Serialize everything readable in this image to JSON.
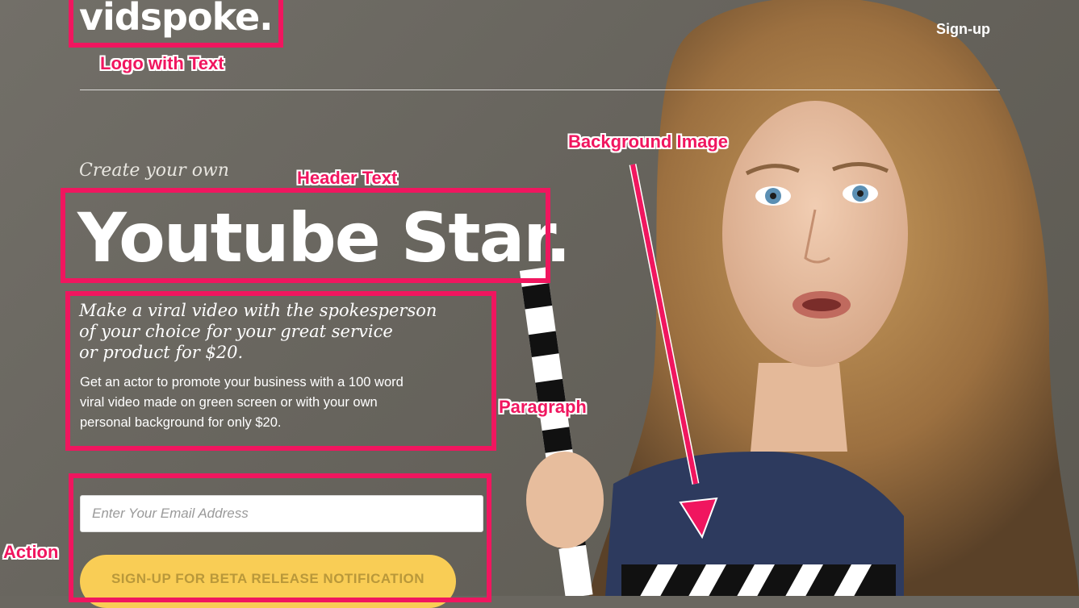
{
  "header": {
    "logo_text": "vidspoke.",
    "signup_link": "Sign-up"
  },
  "hero": {
    "tagline": "Create your own",
    "headline": "Youtube Star.",
    "subhead_lines": [
      "Make a viral video with the spokesperson",
      "of your choice for your great service",
      "or product for $20."
    ],
    "paragraph_lines": [
      "Get an actor to promote your business with a 100 word",
      "viral video made on green screen or with your own",
      "personal background for only $20."
    ]
  },
  "form": {
    "email_placeholder": "Enter Your Email Address",
    "email_value": "",
    "cta_label": "SIGN-UP FOR BETA RELEASE NOTIFICATION"
  },
  "annotations": {
    "logo": "Logo with Text",
    "header": "Header Text",
    "background": "Background Image",
    "paragraph": "Paragraph",
    "action": "Action"
  },
  "colors": {
    "background": "#6a6760",
    "accent_annotation": "#f0165f",
    "cta_button": "#f9cd55",
    "cta_text": "#b9983a",
    "text": "#ffffff"
  },
  "icons": {
    "background_photo": "woman-with-clapperboard-photo",
    "arrow": "annotation-arrow-icon"
  }
}
